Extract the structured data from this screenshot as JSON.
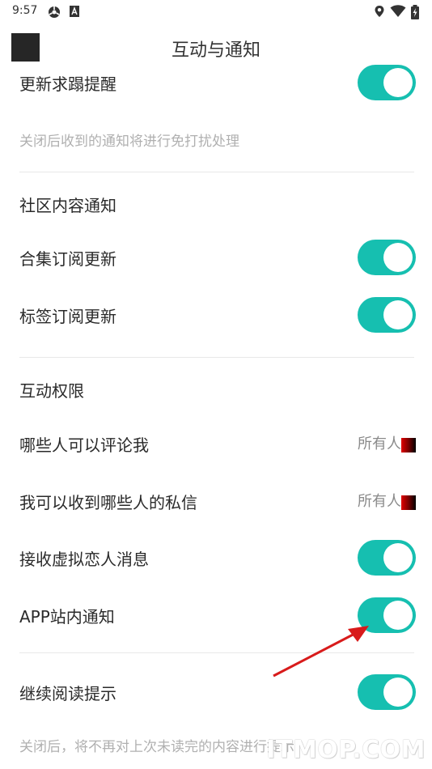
{
  "status": {
    "time": "9:57"
  },
  "header": {
    "title": "互动与通知"
  },
  "rows": {
    "update_reminder": {
      "label": "更新求蹋提醒",
      "on": true
    },
    "update_hint": "关闭后收到的通知将进行免打扰处理",
    "community_section": "社区内容通知",
    "collection_sub": {
      "label": "合集订阅更新",
      "on": true
    },
    "tag_sub": {
      "label": "标签订阅更新",
      "on": true
    },
    "interaction_section": "互动权限",
    "who_comment": {
      "label": "哪些人可以评论我",
      "value": "所有人"
    },
    "who_message": {
      "label": "我可以收到哪些人的私信",
      "value": "所有人"
    },
    "virtual_lover": {
      "label": "接收虚拟恋人消息",
      "on": true
    },
    "app_notice": {
      "label": "APP站内通知",
      "on": true
    },
    "continue_reading": {
      "label": "继续阅读提示",
      "on": true
    },
    "continue_hint": "关闭后，将不再对上次未读完的内容进行提示"
  },
  "watermark": "ITMOP.COM",
  "colors": {
    "accent": "#16bfb0",
    "annotation_arrow": "#d81b1b"
  },
  "icons": [
    "android-system-icon",
    "a-badge-icon",
    "location-icon",
    "wifi-icon",
    "battery-charging-icon"
  ]
}
